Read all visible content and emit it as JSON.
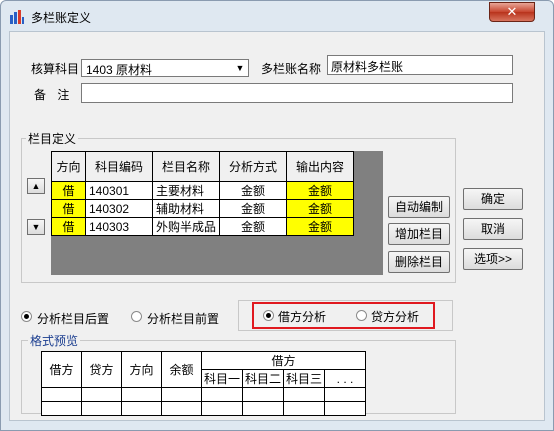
{
  "window": {
    "title": "多栏账定义",
    "close_label": "✕"
  },
  "form": {
    "account_label": "核算科目",
    "account_value": "1403  原材料",
    "ledger_name_label": "多栏账名称",
    "ledger_name_value": "原材料多栏账",
    "remark_label": "备  注",
    "remark_value": ""
  },
  "columns_group": {
    "title": "栏目定义",
    "headers": [
      "方向",
      "科目编码",
      "栏目名称",
      "分析方式",
      "输出内容"
    ],
    "rows": [
      [
        "借",
        "140301",
        "主要材料",
        "金额",
        "金额"
      ],
      [
        "借",
        "140302",
        "辅助材料",
        "金额",
        "金额"
      ],
      [
        "借",
        "140303",
        "外购半成品",
        "金额",
        "金额"
      ]
    ],
    "buttons": {
      "auto_label": "自动编制",
      "add_label": "增加栏目",
      "delete_label": "删除栏目"
    }
  },
  "dialog_buttons": {
    "ok_label": "确定",
    "cancel_label": "取消",
    "options_label": "选项>>"
  },
  "position_options": {
    "after_label": "分析栏目后置",
    "before_label": "分析栏目前置",
    "selected": "after"
  },
  "analysis_options": {
    "debit_label": "借方分析",
    "credit_label": "贷方分析",
    "selected": "debit"
  },
  "preview": {
    "title": "格式预览",
    "headers": [
      "借方",
      "贷方",
      "方向",
      "余额"
    ],
    "group_header": "借方",
    "sub_headers": [
      "科目一",
      "科目二",
      "科目三",
      ". . ."
    ]
  },
  "colors": {
    "highlight": "#ffff00",
    "annotation": "#e0191f",
    "grid_bg": "#808080"
  }
}
